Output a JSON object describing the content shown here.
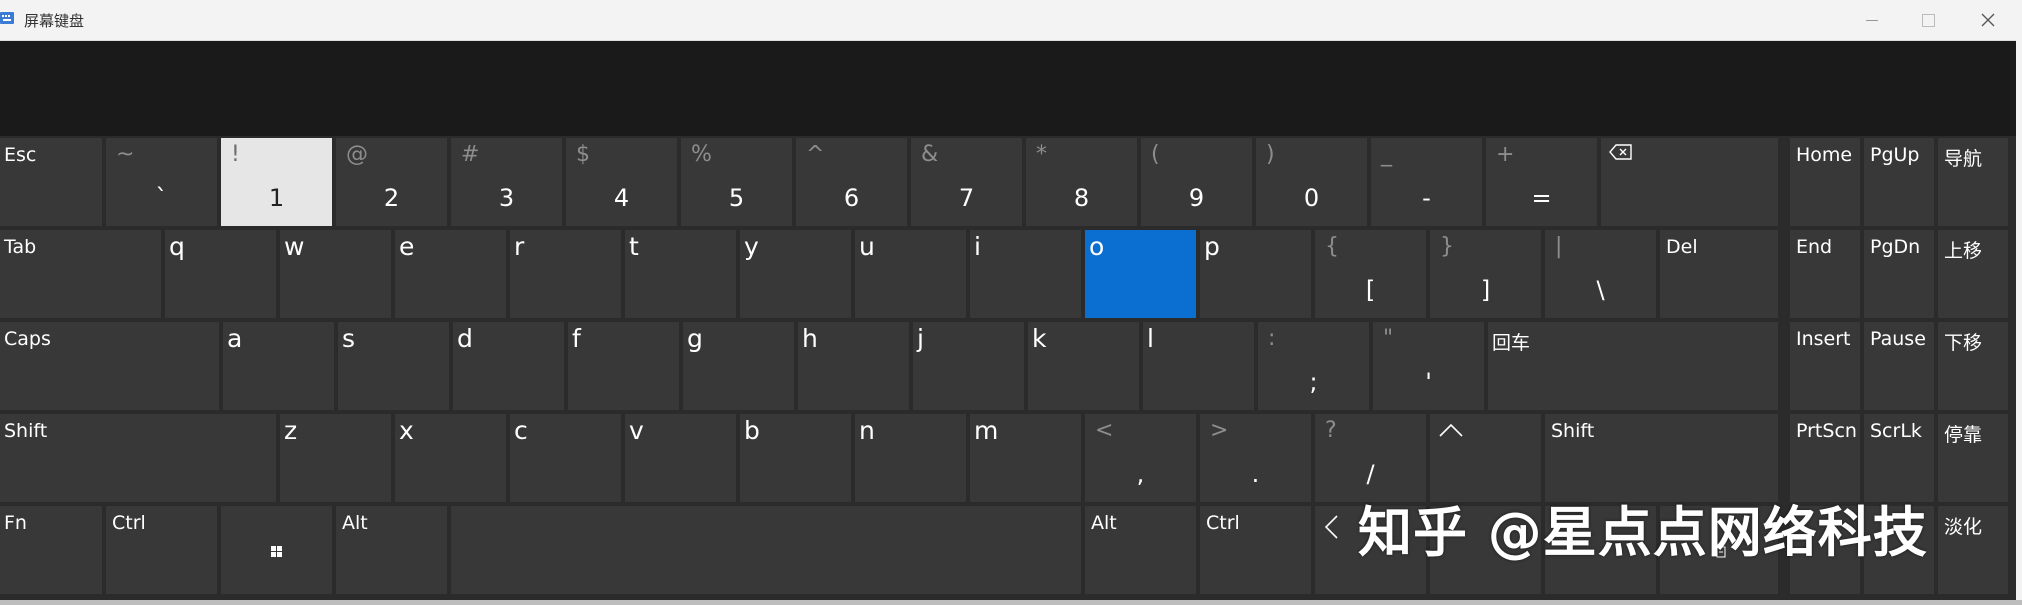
{
  "window": {
    "title": "屏幕键盘"
  },
  "rows": {
    "row1": [
      {
        "label": "Esc"
      },
      {
        "shift": "~",
        "main": "`"
      },
      {
        "shift": "!",
        "main": "1"
      },
      {
        "shift": "@",
        "main": "2"
      },
      {
        "shift": "#",
        "main": "3"
      },
      {
        "shift": "$",
        "main": "4"
      },
      {
        "shift": "%",
        "main": "5"
      },
      {
        "shift": "^",
        "main": "6"
      },
      {
        "shift": "&",
        "main": "7"
      },
      {
        "shift": "*",
        "main": "8"
      },
      {
        "shift": "(",
        "main": "9"
      },
      {
        "shift": ")",
        "main": "0"
      },
      {
        "shift": "_",
        "main": "-"
      },
      {
        "shift": "+",
        "main": "="
      }
    ],
    "row2": [
      {
        "label": "Tab"
      },
      {
        "letter": "q"
      },
      {
        "letter": "w"
      },
      {
        "letter": "e"
      },
      {
        "letter": "r"
      },
      {
        "letter": "t"
      },
      {
        "letter": "y"
      },
      {
        "letter": "u"
      },
      {
        "letter": "i"
      },
      {
        "letter": "o"
      },
      {
        "letter": "p"
      },
      {
        "shift": "{",
        "main": "["
      },
      {
        "shift": "}",
        "main": "]"
      },
      {
        "shift": "|",
        "main": "\\"
      },
      {
        "label": "Del"
      }
    ],
    "row3": [
      {
        "label": "Caps"
      },
      {
        "letter": "a"
      },
      {
        "letter": "s"
      },
      {
        "letter": "d"
      },
      {
        "letter": "f"
      },
      {
        "letter": "g"
      },
      {
        "letter": "h"
      },
      {
        "letter": "j"
      },
      {
        "letter": "k"
      },
      {
        "letter": "l"
      },
      {
        "shift": ":",
        "main": ";"
      },
      {
        "shift": "\"",
        "main": "'"
      },
      {
        "label": "回车"
      }
    ],
    "row4": [
      {
        "label": "Shift"
      },
      {
        "letter": "z"
      },
      {
        "letter": "x"
      },
      {
        "letter": "c"
      },
      {
        "letter": "v"
      },
      {
        "letter": "b"
      },
      {
        "letter": "n"
      },
      {
        "letter": "m"
      },
      {
        "shift": "<",
        "main": ","
      },
      {
        "shift": ">",
        "main": "."
      },
      {
        "shift": "?",
        "main": "/"
      },
      {
        "label": "Shift"
      }
    ],
    "row5": [
      {
        "label": "Fn"
      },
      {
        "label": "Ctrl"
      },
      {
        "label": "Alt"
      },
      {
        "label": "Alt"
      },
      {
        "label": "Ctrl"
      }
    ]
  },
  "nav": {
    "home": "Home",
    "pgup": "PgUp",
    "navigate": "导航",
    "end": "End",
    "pgdn": "PgDn",
    "move_up": "上移",
    "insert": "Insert",
    "pause": "Pause",
    "move_down": "下移",
    "prtscn": "PrtScn",
    "scrlk": "ScrLk",
    "dock": "停靠",
    "fade_partial": "淡化"
  },
  "state": {
    "pressed_key": "1",
    "highlighted_key": "o"
  },
  "watermark": {
    "text": "知乎 @星点点网络科技"
  },
  "colors": {
    "key_bg": "#383838",
    "board_bg": "#2b2b2b",
    "text_area": "#1a1a1a",
    "pressed": "#e6e6e6",
    "highlight": "#0a6fd1"
  }
}
